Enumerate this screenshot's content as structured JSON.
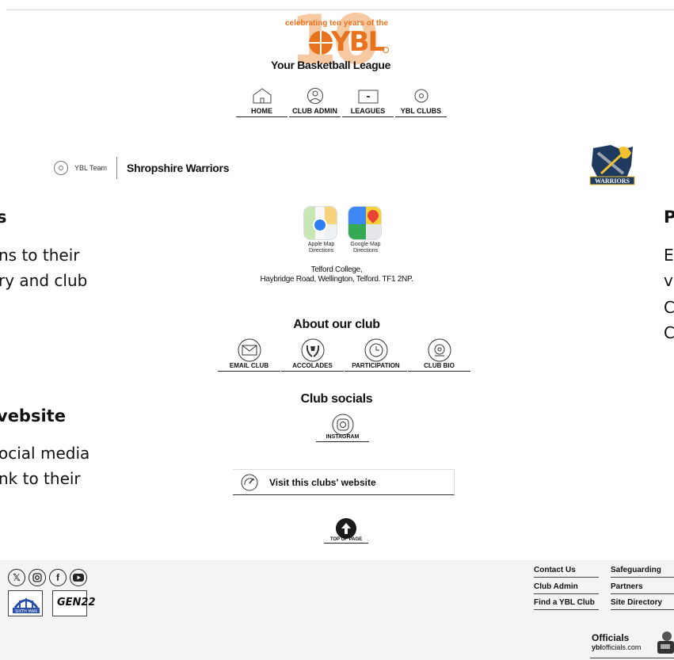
{
  "header": {
    "celebrating": "celebrating ten years of the",
    "brand": "YBL",
    "tagline": "Your Basketball League"
  },
  "nav": [
    {
      "label": "HOME",
      "icon": "home-icon"
    },
    {
      "label": "CLUB ADMIN",
      "icon": "user-icon"
    },
    {
      "label": "LEAGUES",
      "icon": "court-icon"
    },
    {
      "label": "YBL CLUBS",
      "icon": "basketball-icon"
    }
  ],
  "team": {
    "prefix": "YBL Team",
    "name": "Shropshire Warriors",
    "crest_text": "WARRIORS"
  },
  "left_panel": {
    "heading_1": "s",
    "line_1": "ns to their",
    "line_2": "ry and club",
    "heading_2": "vebsite",
    "line_3": "ocial media",
    "line_4": "nk to their"
  },
  "right_panel": {
    "heading": "P",
    "l1": "E",
    "l2": "v",
    "l3": "C",
    "l4": "C"
  },
  "directions": {
    "apple": "Apple Map Directions",
    "google": "Google Map Directions",
    "address_line_1": "Telford College,",
    "address_line_2": "Haybridge Road, Wellington, Telford. TF1 2NP."
  },
  "about": {
    "title": "About our club",
    "items": [
      {
        "label": "EMAIL CLUB",
        "icon": "envelope-icon"
      },
      {
        "label": "ACCOLADES",
        "icon": "laurel-icon"
      },
      {
        "label": "PARTICIPATION",
        "icon": "clock-icon"
      },
      {
        "label": "CLUB BIO",
        "icon": "club-bio-icon"
      }
    ]
  },
  "socials": {
    "title": "Club socials",
    "instagram": "INSTAGRAM"
  },
  "visit": {
    "label": "Visit this clubs' website"
  },
  "top_of_page": "TOP OF PAGE",
  "footer": {
    "links": [
      {
        "label": "Contact Us"
      },
      {
        "label": "Safeguarding"
      },
      {
        "label": "Club Admin"
      },
      {
        "label": "Partners"
      },
      {
        "label": "Find a YBL Club"
      },
      {
        "label": "Site Directory"
      }
    ],
    "social_icons": [
      "x-icon",
      "instagram-icon",
      "facebook-icon",
      "youtube-icon"
    ],
    "sixth_man": "SIXTH MAN",
    "gen22": "GEN22",
    "officials_title": "Officials",
    "officials_pre": "ybl",
    "officials_post": "officials.com"
  },
  "colors": {
    "brand_orange": "#e8731e",
    "text": "#111111",
    "footer_bg": "#f4f4f4"
  }
}
